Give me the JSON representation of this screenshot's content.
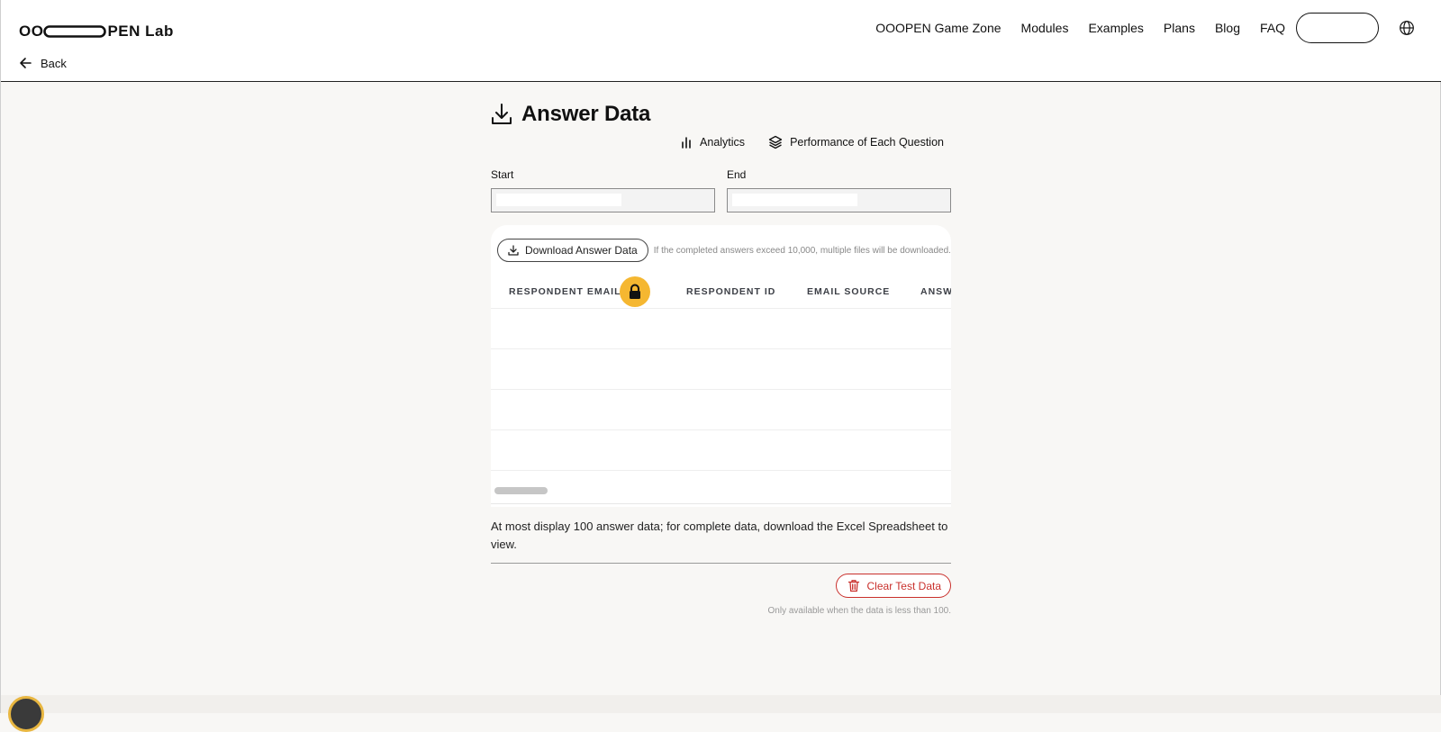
{
  "brand": {
    "logo_text_left": "OO",
    "logo_text_right": "PEN Lab"
  },
  "header": {
    "back_label": "Back"
  },
  "nav": {
    "items": [
      "OOOPEN Game Zone",
      "Modules",
      "Examples",
      "Plans",
      "Blog",
      "FAQ"
    ],
    "account_button_label": "",
    "language_icon": "globe-icon"
  },
  "page": {
    "title": "Answer Data",
    "title_icon": "download-icon",
    "links": {
      "analytics": "Analytics",
      "performance": "Performance of Each Question"
    }
  },
  "filters": {
    "start_label": "Start",
    "end_label": "End",
    "start_value": "",
    "end_value": ""
  },
  "table": {
    "download_label": "Download Answer Data",
    "download_note": "If the completed answers exceed 10,000, multiple files will be downloaded.",
    "columns": [
      "RESPONDENT EMAIL",
      "RESPONDENT ID",
      "EMAIL SOURCE",
      "ANSWER"
    ],
    "locked_column": "RESPONDENT EMAIL",
    "rows": []
  },
  "footer": {
    "note": "At most display 100 answer data; for complete data, download the Excel Spreadsheet to view.",
    "clear_label": "Clear Test Data",
    "clear_note": "Only available when the data is less than 100."
  },
  "colors": {
    "accent_lock": "#f5b731",
    "danger": "#c9302c",
    "page_bg": "#f8f7f5",
    "header_bg": "#ffffff"
  }
}
